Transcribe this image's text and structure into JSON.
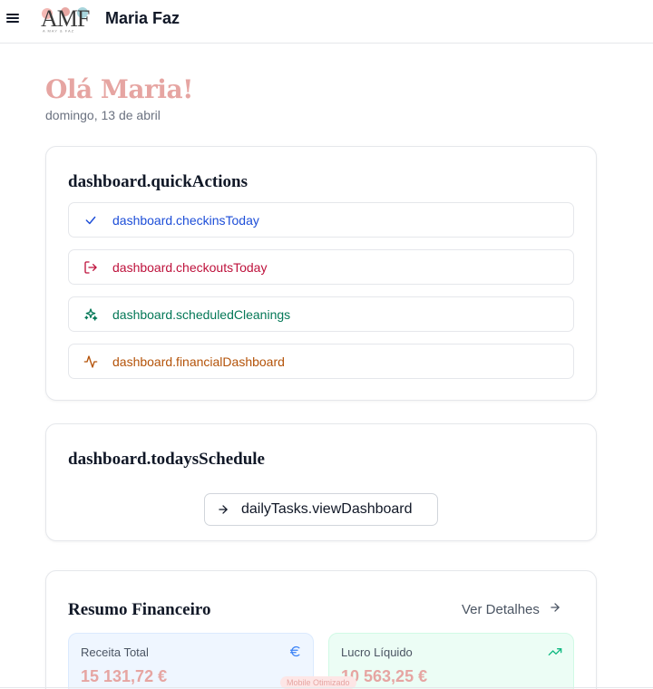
{
  "header": {
    "app_title": "Maria Faz",
    "logo_letters": "AMF",
    "logo_subtext": "A MAY & FAZ",
    "menu_icon": "hamburger-icon"
  },
  "greeting": {
    "title": "Olá Maria!",
    "date": "domingo, 13 de abril"
  },
  "quick_actions": {
    "title": "dashboard.quickActions",
    "items": [
      {
        "label": "dashboard.checkinsToday",
        "icon": "check-icon",
        "color": "#1d4ed8"
      },
      {
        "label": "dashboard.checkoutsToday",
        "icon": "logout-icon",
        "color": "#be123c"
      },
      {
        "label": "dashboard.scheduledCleanings",
        "icon": "sparkles-icon",
        "color": "#047857"
      },
      {
        "label": "dashboard.financialDashboard",
        "icon": "activity-icon",
        "color": "#b45309"
      }
    ]
  },
  "todays_schedule": {
    "title": "dashboard.todaysSchedule",
    "button_label": "dailyTasks.viewDashboard",
    "button_icon": "arrow-right-icon"
  },
  "financial_summary": {
    "title": "Resumo Financeiro",
    "details_link": "Ver Detalhes",
    "stats": [
      {
        "label": "Receita Total",
        "value": "15 131,72 €",
        "icon": "euro-icon",
        "bg": "#eff6ff",
        "border": "#dbeafe",
        "icon_color": "#3b82f6"
      },
      {
        "label": "Lucro Líquido",
        "value": "10 563,25 €",
        "icon": "trending-up-icon",
        "bg": "#ecfdf5",
        "border": "#d1fae5",
        "icon_color": "#10b981"
      }
    ]
  },
  "badge": "Mobile Otimizado"
}
